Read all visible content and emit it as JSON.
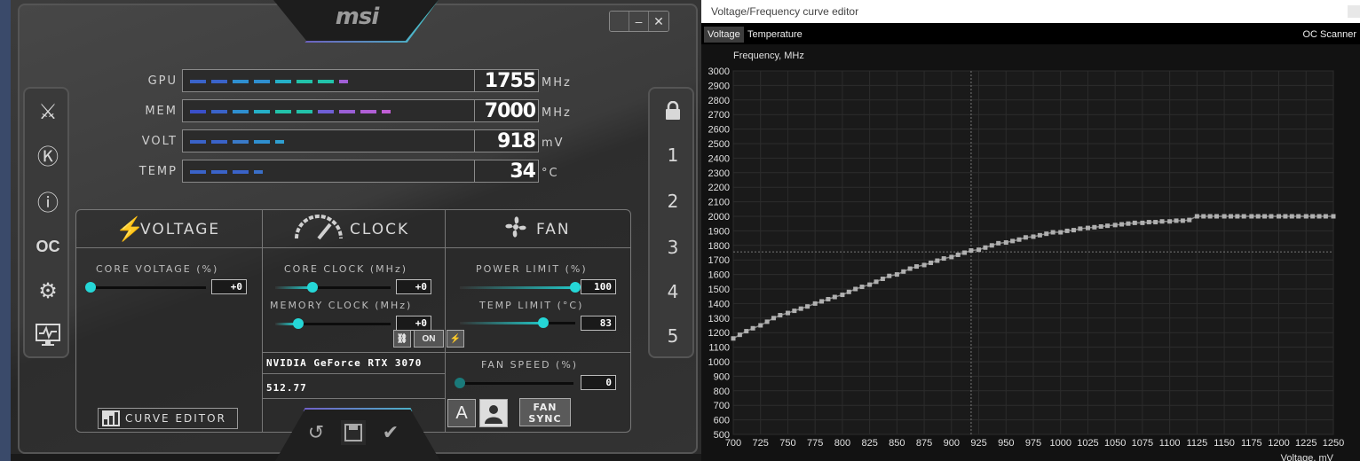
{
  "afterburner": {
    "logo": "msi",
    "monitor": [
      {
        "label": "GPU",
        "value": "1755",
        "unit": "MHz",
        "fill": 0.58,
        "colors": [
          "#3a63c9",
          "#3a63c9",
          "#2f8fd0",
          "#2f8fd0",
          "#25b0c8",
          "#22c3aa",
          "#22c3aa",
          "#a15fd5"
        ]
      },
      {
        "label": "MEM",
        "value": "7000",
        "unit": "MHz",
        "fill": 1.0,
        "colors": [
          "#3a4fc9",
          "#3a63c9",
          "#2f8fd0",
          "#25b0c8",
          "#22c3aa",
          "#22c3aa",
          "#6f5fd5",
          "#9a5fd5",
          "#b05fd5",
          "#c05fd5"
        ]
      },
      {
        "label": "VOLT",
        "value": "918",
        "unit": "mV",
        "fill": 0.38,
        "colors": [
          "#3a63c9",
          "#3a63c9",
          "#3a7ac9",
          "#2f8fd0",
          "#2f9fd0"
        ]
      },
      {
        "label": "TEMP",
        "value": "34",
        "unit": "°C",
        "fill": 0.29,
        "colors": [
          "#3a63c9",
          "#3a63c9",
          "#3a63c9",
          "#3a6fc9"
        ]
      }
    ],
    "sections": {
      "voltage": {
        "title": "VOLTAGE",
        "core_voltage_label": "CORE VOLTAGE  (%)",
        "core_voltage_value": "+0",
        "curve_editor_label": "CURVE EDITOR"
      },
      "clock": {
        "title": "CLOCK",
        "core_clock_label": "CORE CLOCK (MHz)",
        "core_clock_value": "+0",
        "memory_clock_label": "MEMORY CLOCK (MHz)",
        "memory_clock_value": "+0",
        "gpu_name": "NVIDIA GeForce RTX 3070",
        "driver": "512.77"
      },
      "fan": {
        "title": "FAN",
        "power_limit_label": "POWER LIMIT  (%)",
        "power_limit_value": "100",
        "temp_limit_label": "TEMP LIMIT  (°C)",
        "temp_limit_value": "83",
        "link_state": "ON",
        "fan_speed_label": "FAN SPEED  (%)",
        "fan_speed_value": "0",
        "auto_label": "A",
        "fan_sync_line1": "FAN",
        "fan_sync_line2": "SYNC"
      }
    },
    "profiles": [
      "1",
      "2",
      "3",
      "4",
      "5"
    ]
  },
  "curve_editor": {
    "window_title": "Voltage/Frequency curve editor",
    "tabs": [
      "Voltage",
      "Temperature"
    ],
    "right_tab": "OC Scanner"
  },
  "chart_data": {
    "type": "line",
    "ylabel": "Frequency, MHz",
    "xlabel": "Voltage, mV",
    "xlim": [
      700,
      1250
    ],
    "ylim": [
      500,
      3000
    ],
    "xticks": [
      700,
      725,
      750,
      775,
      800,
      825,
      850,
      875,
      900,
      925,
      950,
      975,
      1000,
      1025,
      1050,
      1075,
      1100,
      1125,
      1150,
      1175,
      1200,
      1225,
      1250
    ],
    "yticks": [
      500,
      600,
      700,
      800,
      900,
      1000,
      1100,
      1200,
      1300,
      1400,
      1500,
      1600,
      1700,
      1800,
      1900,
      2000,
      2100,
      2200,
      2300,
      2400,
      2500,
      2600,
      2700,
      2800,
      2900,
      3000
    ],
    "grid": true,
    "cursor": {
      "x": 918,
      "y": 1755
    },
    "x": [
      700,
      706,
      712,
      718,
      725,
      731,
      737,
      743,
      750,
      756,
      762,
      768,
      775,
      781,
      787,
      793,
      800,
      806,
      812,
      818,
      825,
      831,
      837,
      843,
      850,
      856,
      862,
      868,
      875,
      881,
      887,
      893,
      900,
      906,
      912,
      918,
      925,
      931,
      937,
      943,
      950,
      956,
      962,
      968,
      975,
      981,
      987,
      993,
      1000,
      1006,
      1012,
      1018,
      1025,
      1031,
      1037,
      1043,
      1050,
      1056,
      1062,
      1068,
      1075,
      1081,
      1087,
      1093,
      1100,
      1106,
      1112,
      1118,
      1125,
      1131,
      1137,
      1143,
      1150,
      1156,
      1162,
      1168,
      1175,
      1181,
      1187,
      1193,
      1200,
      1206,
      1212,
      1218,
      1225,
      1231,
      1237,
      1243,
      1250
    ],
    "y": [
      1160,
      1185,
      1210,
      1230,
      1250,
      1275,
      1300,
      1320,
      1335,
      1350,
      1365,
      1380,
      1400,
      1415,
      1430,
      1445,
      1460,
      1480,
      1500,
      1515,
      1530,
      1550,
      1570,
      1590,
      1600,
      1620,
      1640,
      1655,
      1665,
      1680,
      1695,
      1710,
      1720,
      1735,
      1750,
      1765,
      1770,
      1785,
      1800,
      1815,
      1820,
      1830,
      1840,
      1855,
      1860,
      1870,
      1880,
      1890,
      1890,
      1900,
      1905,
      1915,
      1920,
      1925,
      1930,
      1935,
      1940,
      1945,
      1950,
      1955,
      1955,
      1960,
      1960,
      1965,
      1965,
      1970,
      1970,
      1975,
      2000,
      2000,
      2000,
      2000,
      2000,
      2000,
      2000,
      2000,
      2000,
      2000,
      2000,
      2000,
      2000,
      2000,
      2000,
      2000,
      2000,
      2000,
      2000,
      2000,
      2000
    ]
  }
}
